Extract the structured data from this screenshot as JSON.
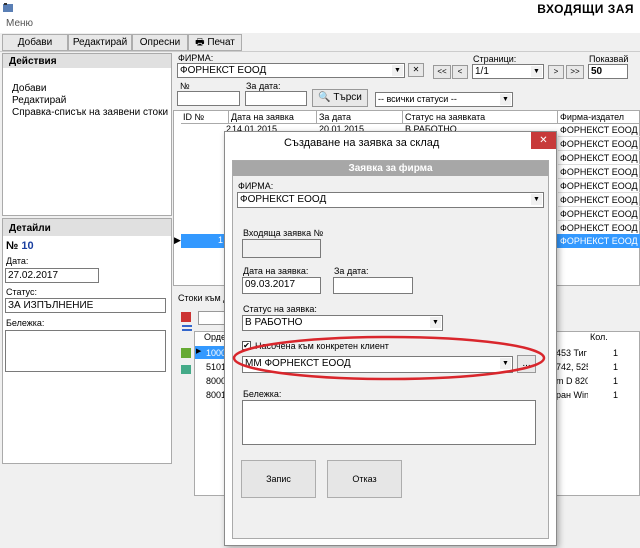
{
  "window": {
    "title": "ВХОДЯЩИ ЗАЯ"
  },
  "menu": {
    "label": "Меню"
  },
  "toolbar": {
    "add": "Добави",
    "edit": "Редактирай",
    "refresh": "Опресни",
    "print": "Печат"
  },
  "actions": {
    "title": "Действия",
    "items": [
      "Добави",
      "Редактирай",
      "Справка-списък на заявени стоки"
    ]
  },
  "filters": {
    "firm_label": "ФИРМА:",
    "firm_value": "ФОРНЕКСТ ЕООД",
    "pages_label": "Страници:",
    "pages_value": "1/1",
    "shown_label": "Показвай",
    "shown_value": "50",
    "no_label": "№",
    "date_label": "За дата:",
    "search_label": "Търси",
    "status_value": "-- всички статуси --"
  },
  "grid": {
    "headers": [
      "ID №",
      "Дата на заявка",
      "За дата",
      "Статус на заявката",
      "Фирма-издател"
    ],
    "row0": {
      "id": "2",
      "date": "14.01.2015",
      "for_date": "20.01.2015",
      "status": "В РАБОТНО"
    },
    "firm_cells": [
      "ФОРНЕКСТ ЕООД",
      "ФОРНЕКСТ ЕООД",
      "ФОРНЕКСТ ЕООД",
      "ФОРНЕКСТ ЕООД",
      "ФОРНЕКСТ ЕООД",
      "ФОРНЕКСТ ЕООД",
      "ФОРНЕКСТ ЕООД",
      "ФОРНЕКСТ ЕООД",
      "ФОРНЕКСТ ЕООД"
    ],
    "selected_id": "1"
  },
  "details": {
    "title": "Детайли",
    "no_prefix": "№",
    "no": "10",
    "date_label": "Дата:",
    "date_value": "27.02.2017",
    "status_label": "Статус:",
    "status_value": "ЗА ИЗПЪЛНЕНИЕ",
    "note_label": "Бележка:"
  },
  "subgrid": {
    "label": "Стоки към д",
    "headers": {
      "order": "Орде",
      "qty": "Кол."
    },
    "rows": [
      {
        "code": "1000",
        "desc": "453 Тиг",
        "qty": "1"
      },
      {
        "code": "5101",
        "desc": "742, 525",
        "qty": "1"
      },
      {
        "code": "8000",
        "desc": "m D 820",
        "qty": "1"
      },
      {
        "code": "8001",
        "desc": "рaн Win",
        "qty": "1"
      }
    ]
  },
  "dialog": {
    "title": "Създаване на заявка за склад",
    "section": "Заявка за фирма",
    "firm_label": "ФИРМА:",
    "firm_value": "ФОРНЕКСТ ЕООД",
    "incoming_label": "Входяща заявка №",
    "incoming_value": "",
    "order_date_label": "Дата на заявка:",
    "order_date_value": "09.03.2017",
    "for_date_label": "За дата:",
    "for_date_value": "",
    "status_label": "Статус на заявка:",
    "status_value": "В РАБОТНО",
    "client_check_label": "Насочена към конкретен клиент",
    "client_value": "ММ ФОРНЕКСТ ЕООД",
    "note_label": "Бележка:",
    "save": "Запис",
    "cancel": "Отказ",
    "close_glyph": "✕",
    "ellipsis": "..."
  },
  "highlight_color": "#d9262c"
}
